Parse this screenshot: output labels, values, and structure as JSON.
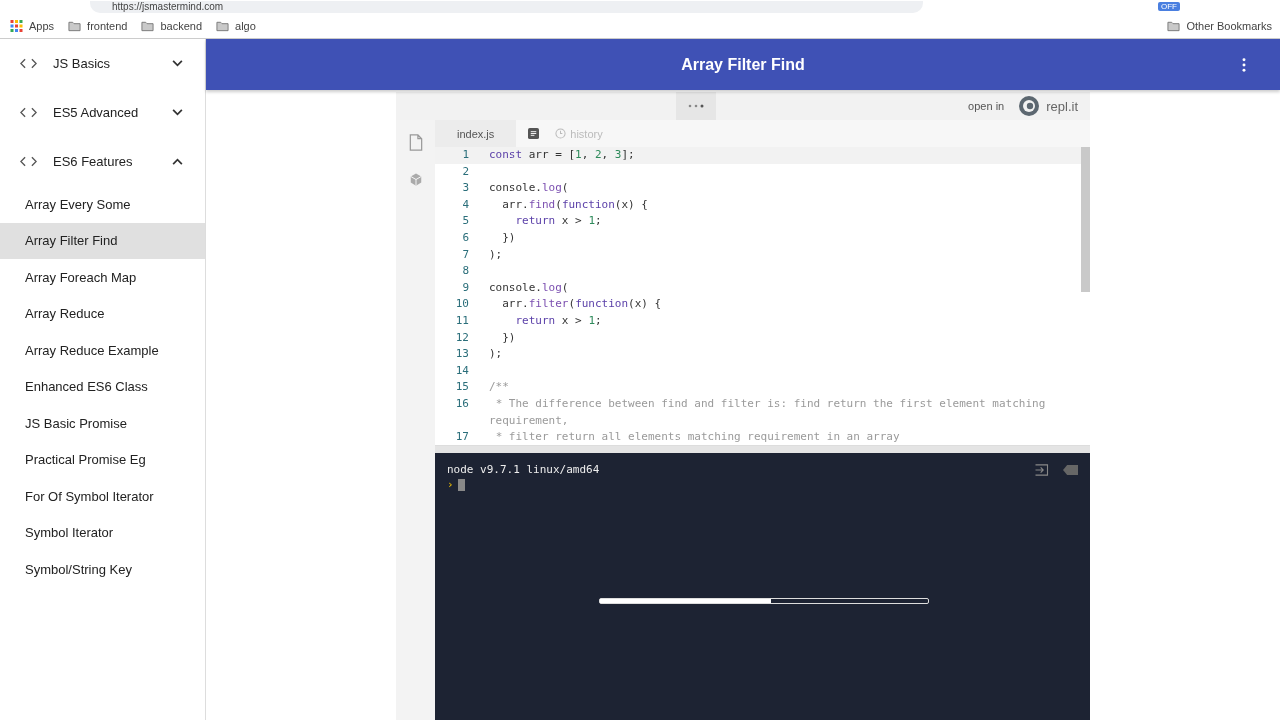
{
  "browser": {
    "url": "https://jsmastermind.com",
    "bookmarks": [
      {
        "label": "Apps",
        "kind": "apps"
      },
      {
        "label": "frontend",
        "kind": "folder"
      },
      {
        "label": "backend",
        "kind": "folder"
      },
      {
        "label": "algo",
        "kind": "folder"
      }
    ],
    "other_bookmarks": "Other Bookmarks",
    "extension_badge": "OFF"
  },
  "sidebar": {
    "groups": [
      {
        "label": "JS Basics",
        "expanded": false
      },
      {
        "label": "ES5 Advanced",
        "expanded": false
      },
      {
        "label": "ES6 Features",
        "expanded": true,
        "items": [
          {
            "label": "Array Every Some",
            "selected": false
          },
          {
            "label": "Array Filter Find",
            "selected": true
          },
          {
            "label": "Array Foreach Map",
            "selected": false
          },
          {
            "label": "Array Reduce",
            "selected": false
          },
          {
            "label": "Array Reduce Example",
            "selected": false
          },
          {
            "label": "Enhanced ES6 Class",
            "selected": false
          },
          {
            "label": "JS Basic Promise",
            "selected": false
          },
          {
            "label": "Practical Promise Eg",
            "selected": false
          },
          {
            "label": "For Of Symbol Iterator",
            "selected": false
          },
          {
            "label": "Symbol Iterator",
            "selected": false
          },
          {
            "label": "Symbol/String Key",
            "selected": false
          }
        ]
      }
    ]
  },
  "header": {
    "title": "Array Filter Find"
  },
  "repl": {
    "open_in": "open in",
    "brand": "repl.it",
    "tabs": [
      {
        "label": "index.js",
        "kind": "file",
        "selected": true
      },
      {
        "label": "history",
        "kind": "history",
        "selected": false
      }
    ],
    "code": [
      {
        "number": "1",
        "active": true,
        "tokens": [
          {
            "kind": "keyword",
            "text": "const"
          },
          {
            "kind": "plain",
            "text": " arr = ["
          },
          {
            "kind": "number",
            "text": "1"
          },
          {
            "kind": "plain",
            "text": ", "
          },
          {
            "kind": "number",
            "text": "2"
          },
          {
            "kind": "plain",
            "text": ", "
          },
          {
            "kind": "number",
            "text": "3"
          },
          {
            "kind": "plain",
            "text": "];"
          }
        ]
      },
      {
        "number": "2",
        "active": false
      },
      {
        "number": "3",
        "active": false,
        "tokens": [
          {
            "kind": "plain",
            "text": "console."
          },
          {
            "kind": "method",
            "text": "log"
          },
          {
            "kind": "plain",
            "text": "("
          }
        ]
      },
      {
        "number": "4",
        "active": false,
        "tokens": [
          {
            "kind": "plain",
            "text": "  arr."
          },
          {
            "kind": "method",
            "text": "find"
          },
          {
            "kind": "plain",
            "text": "("
          },
          {
            "kind": "keyword",
            "text": "function"
          },
          {
            "kind": "plain",
            "text": "(x) {"
          }
        ]
      },
      {
        "number": "5",
        "active": false,
        "tokens": [
          {
            "kind": "keyword",
            "text": "    return"
          },
          {
            "kind": "plain",
            "text": " x > "
          },
          {
            "kind": "number",
            "text": "1"
          },
          {
            "kind": "plain",
            "text": ";"
          }
        ]
      },
      {
        "number": "6",
        "active": false,
        "tokens": [
          {
            "kind": "plain",
            "text": "  })"
          }
        ]
      },
      {
        "number": "7",
        "active": false,
        "tokens": [
          {
            "kind": "plain",
            "text": ");"
          }
        ]
      },
      {
        "number": "8",
        "active": false
      },
      {
        "number": "9",
        "active": false,
        "tokens": [
          {
            "kind": "plain",
            "text": "console."
          },
          {
            "kind": "method",
            "text": "log"
          },
          {
            "kind": "plain",
            "text": "("
          }
        ]
      },
      {
        "number": "10",
        "active": false,
        "tokens": [
          {
            "kind": "plain",
            "text": "  arr."
          },
          {
            "kind": "method",
            "text": "filter"
          },
          {
            "kind": "plain",
            "text": "("
          },
          {
            "kind": "keyword",
            "text": "function"
          },
          {
            "kind": "plain",
            "text": "(x) {"
          }
        ]
      },
      {
        "number": "11",
        "active": false,
        "tokens": [
          {
            "kind": "keyword",
            "text": "    return"
          },
          {
            "kind": "plain",
            "text": " x > "
          },
          {
            "kind": "number",
            "text": "1"
          },
          {
            "kind": "plain",
            "text": ";"
          }
        ]
      },
      {
        "number": "12",
        "active": false,
        "tokens": [
          {
            "kind": "plain",
            "text": "  })"
          }
        ]
      },
      {
        "number": "13",
        "active": false,
        "tokens": [
          {
            "kind": "plain",
            "text": ");"
          }
        ]
      },
      {
        "number": "14",
        "active": false
      },
      {
        "number": "15",
        "active": false,
        "tokens": [
          {
            "kind": "comment",
            "text": "/**"
          }
        ]
      },
      {
        "number": "16",
        "active": false,
        "tokens": [
          {
            "kind": "comment",
            "text": " * The difference between find and filter is: find return the first element matching requirement,"
          }
        ]
      },
      {
        "number": "17",
        "active": false,
        "tokens": [
          {
            "kind": "comment",
            "text": " * filter return all elements matching requirement in an array"
          }
        ]
      }
    ],
    "console": {
      "banner": "node v9.7.1 linux/amd64",
      "prompt": "›"
    }
  },
  "video": {
    "level": 0.52
  }
}
